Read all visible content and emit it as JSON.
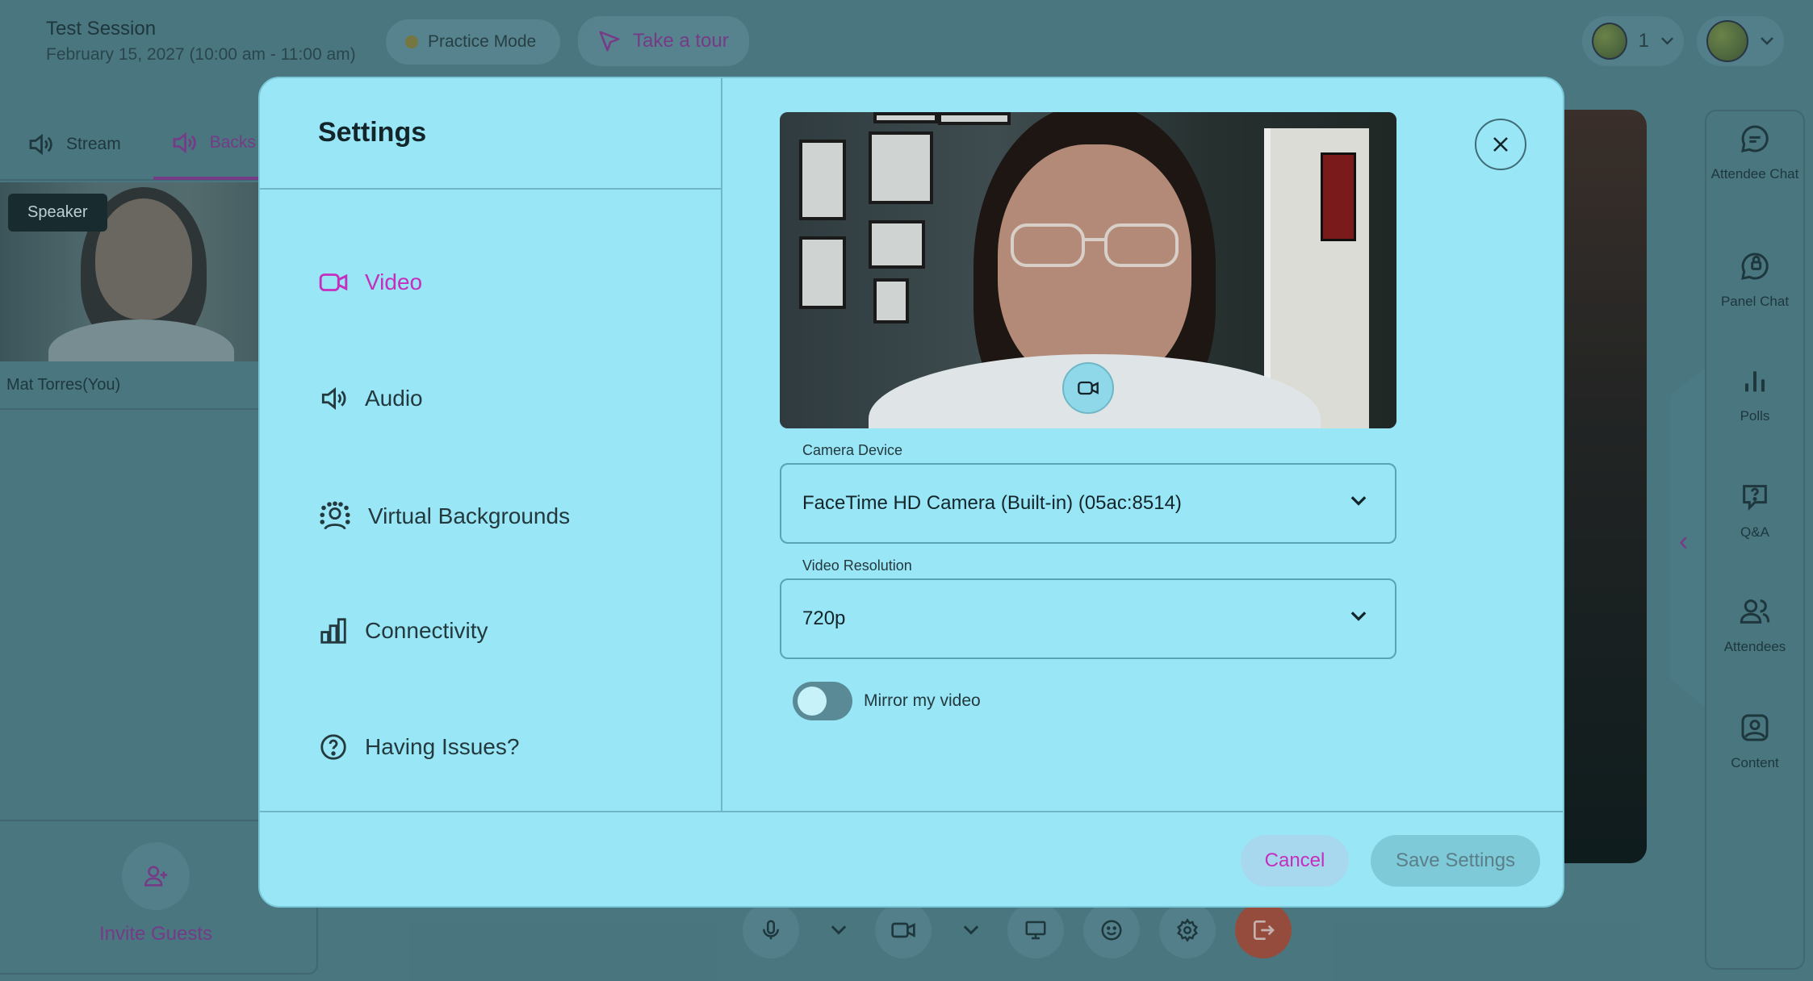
{
  "session": {
    "title": "Test Session",
    "date": "February 15, 2027 (10:00 am - 11:00 am)"
  },
  "topbar": {
    "practice_mode": "Practice Mode",
    "take_tour": "Take a tour",
    "attendee_count": "1"
  },
  "left_panel": {
    "tabs": [
      {
        "label": "Stream",
        "icon": "speaker-icon"
      },
      {
        "label": "Backs",
        "icon": "speaker-icon"
      }
    ],
    "speaker_tag": "Speaker",
    "speaker_name": "Mat Torres(You)",
    "invite_label": "Invite Guests"
  },
  "right_rail": {
    "items": [
      {
        "label": "Attendee Chat",
        "icon": "chat-icon"
      },
      {
        "label": "Panel Chat",
        "icon": "panel-chat-icon"
      },
      {
        "label": "Polls",
        "icon": "polls-icon"
      },
      {
        "label": "Q&A",
        "icon": "qa-icon"
      },
      {
        "label": "Attendees",
        "icon": "attendees-icon"
      },
      {
        "label": "Content",
        "icon": "content-icon"
      }
    ]
  },
  "settings": {
    "title": "Settings",
    "nav": [
      {
        "label": "Video",
        "icon": "video-icon",
        "active": true
      },
      {
        "label": "Audio",
        "icon": "audio-icon",
        "active": false
      },
      {
        "label": "Virtual Backgrounds",
        "icon": "virtual-backgrounds-icon",
        "active": false
      },
      {
        "label": "Connectivity",
        "icon": "connectivity-icon",
        "active": false
      },
      {
        "label": "Having Issues?",
        "icon": "help-icon",
        "active": false
      }
    ],
    "camera_device": {
      "label": "Camera Device",
      "value": "FaceTime HD Camera (Built-in) (05ac:8514)"
    },
    "video_resolution": {
      "label": "Video Resolution",
      "value": "720p"
    },
    "mirror_label": "Mirror my video",
    "mirror_enabled": false,
    "cancel_label": "Cancel",
    "save_label": "Save Settings"
  },
  "colors": {
    "accent": "#c42fbe",
    "modal_bg": "#98e6f6",
    "app_bg": "#4e7882",
    "exit_button": "#b5412a"
  }
}
